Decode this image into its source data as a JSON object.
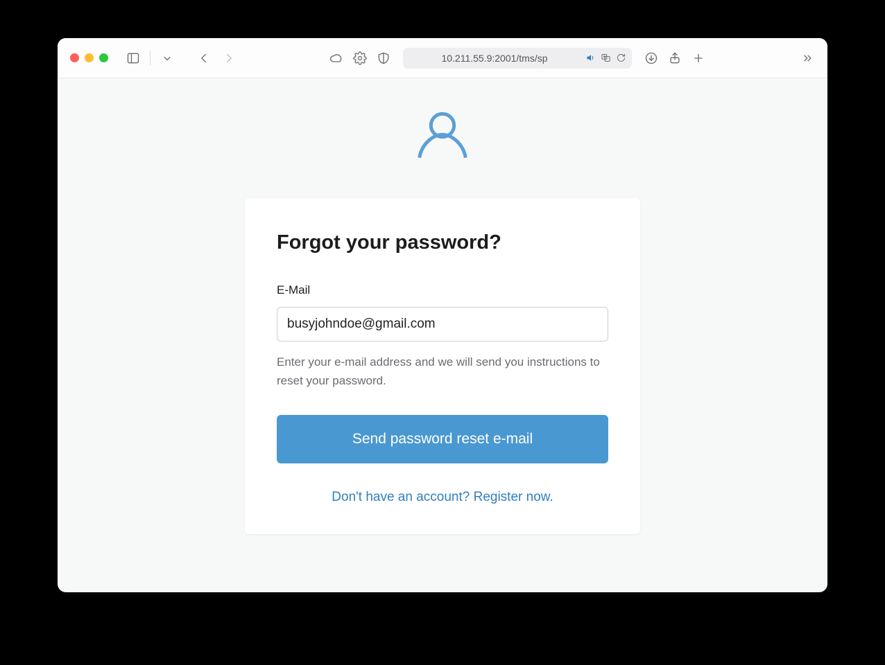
{
  "browser": {
    "url": "10.211.55.9:2001/tms/sp"
  },
  "page": {
    "heading": "Forgot your password?",
    "email_label": "E-Mail",
    "email_value": "busyjohndoe@gmail.com",
    "helper_text": "Enter your e-mail address and we will send you instructions to reset your password.",
    "submit_label": "Send password reset e-mail",
    "register_link": "Don't have an account? Register now."
  }
}
